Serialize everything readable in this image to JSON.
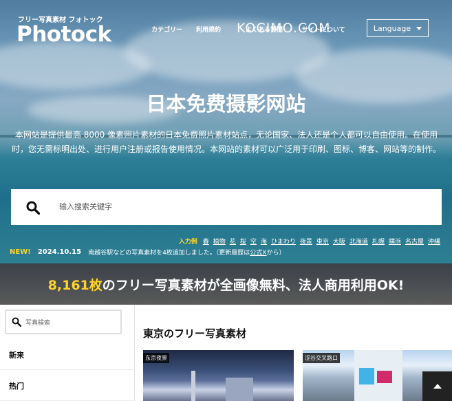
{
  "header": {
    "logo_subtitle": "フリー写真素材 フォトック",
    "logo": "Photock",
    "nav": [
      "カテゴリー",
      "利用規約",
      "よくある質問",
      "サイトについて"
    ],
    "watermark": "KOCIMO.COM",
    "language_button": "Language"
  },
  "hero": {
    "title": "日本免费摄影网站",
    "description": "本网站是提供最高 8000 像素照片素材的日本免费照片素材站点，无论国家、法人还是个人都可以自由使用。在使用时，您无需标明出处、进行用户注册或报告使用情况。本网站的素材可以广泛用于印刷、图标、博客、网站等的制作。",
    "search_placeholder": "输入搜索关键字"
  },
  "keywords": {
    "label": "入力例",
    "items": [
      "春",
      "植物",
      "花",
      "桜",
      "空",
      "海",
      "ひまわり",
      "夜景",
      "東京",
      "大阪",
      "北海道",
      "札幌",
      "横浜",
      "名古屋",
      "沖縄"
    ]
  },
  "news": {
    "badge": "NEW!",
    "date": "2024.10.15",
    "text": "南越谷駅などの写真素材を4枚追加しました。（更新履歴は",
    "link": "公式X",
    "suffix": "から）"
  },
  "banner": {
    "count": "8,161枚",
    "text": "のフリー写真素材が全画像無料、法人商用利用OK!"
  },
  "sidebar": {
    "search_placeholder": "写真検索",
    "items": [
      "新来",
      "热门"
    ]
  },
  "main": {
    "section_title": "東京のフリー写真素材",
    "photos": [
      {
        "label": "东京夜景"
      },
      {
        "label": "涩谷交叉路口"
      }
    ]
  },
  "icons": {
    "search": "search-icon",
    "caret": "caret-down-icon",
    "back_to_top": "arrow-up-icon"
  }
}
